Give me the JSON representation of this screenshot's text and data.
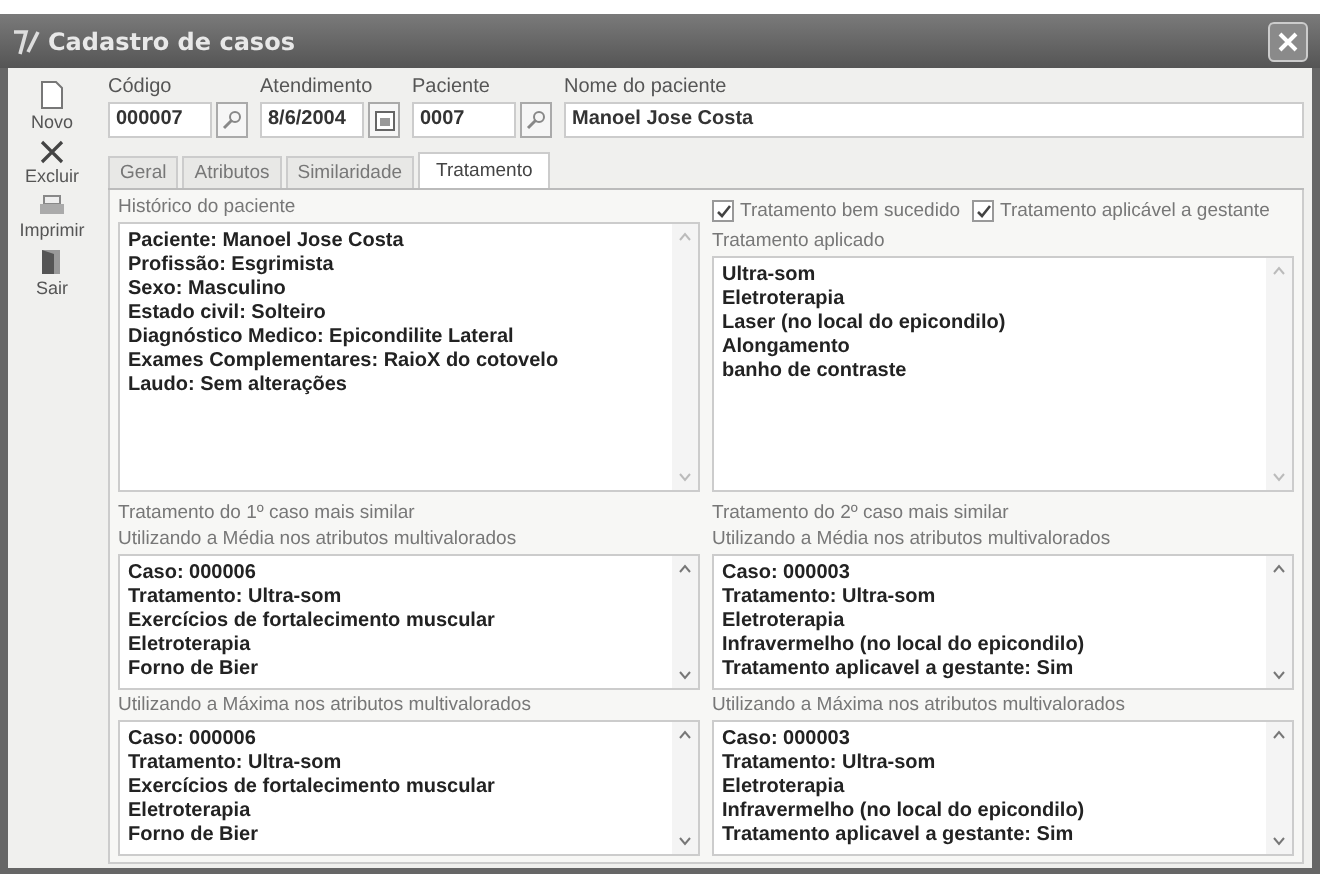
{
  "window": {
    "title": "Cadastro de casos"
  },
  "toolbar": [
    {
      "label": "Novo",
      "kind": "new"
    },
    {
      "label": "Excluir",
      "kind": "delete"
    },
    {
      "label": "Imprimir",
      "kind": "print"
    },
    {
      "label": "Sair",
      "kind": "exit"
    }
  ],
  "fields": [
    {
      "label": "Código",
      "value": "000007",
      "kind": "lookup"
    },
    {
      "label": "Atendimento",
      "value": "8/6/2004",
      "kind": "date"
    },
    {
      "label": "Paciente",
      "value": "0007",
      "kind": "lookup"
    },
    {
      "label": "Nome do paciente",
      "value": "Manoel Jose Costa",
      "kind": "text"
    }
  ],
  "tabs": [
    {
      "label": "Geral",
      "selected": false
    },
    {
      "label": "Atributos",
      "selected": false
    },
    {
      "label": "Similaridade",
      "selected": false
    },
    {
      "label": "Tratamento",
      "selected": true
    }
  ],
  "left": {
    "top_label": "Histórico do paciente",
    "top_lines": [
      "Paciente: Manoel Jose Costa",
      "Profissão: Esgrimista",
      "Sexo: Masculino",
      "Estado civil: Solteiro",
      "Diagnóstico Medico: Epicondilite Lateral",
      "Exames Complementares: RaioX do cotovelo",
      "Laudo: Sem alterações"
    ],
    "similar_label": "Tratamento do 1º caso mais similar",
    "lists": [
      {
        "label": "Utilizando a Média nos atributos multivalorados",
        "lines": [
          "Caso: 000006",
          "Tratamento: Ultra-som",
          "Exercícios de fortalecimento muscular",
          "Eletroterapia",
          "Forno de Bier"
        ]
      },
      {
        "label": "Utilizando a Máxima nos atributos multivalorados",
        "lines": [
          "Caso: 000006",
          "Tratamento: Ultra-som",
          "Exercícios de fortalecimento muscular",
          "Eletroterapia",
          "Forno de Bier"
        ]
      }
    ]
  },
  "right": {
    "checkboxes": [
      {
        "label": "Tratamento bem sucedido",
        "checked": true
      },
      {
        "label": "Tratamento aplicável a gestante",
        "checked": true
      }
    ],
    "top_label": "Tratamento aplicado",
    "top_lines": [
      "Ultra-som",
      "Eletroterapia",
      "Laser (no local do epicondilo)",
      "Alongamento",
      "banho de contraste"
    ],
    "similar_label": "Tratamento do 2º caso mais similar",
    "lists": [
      {
        "label": "Utilizando a Média nos atributos multivalorados",
        "lines": [
          "Caso: 000003",
          "Tratamento: Ultra-som",
          "Eletroterapia",
          "Infravermelho (no local do epicondilo)",
          "Tratamento aplicavel a gestante: Sim"
        ]
      },
      {
        "label": "Utilizando a Máxima nos atributos multivalorados",
        "lines": [
          "Caso: 000003",
          "Tratamento: Ultra-som",
          "Eletroterapia",
          "Infravermelho (no local do epicondilo)",
          "Tratamento aplicavel a gestante: Sim"
        ]
      }
    ]
  }
}
